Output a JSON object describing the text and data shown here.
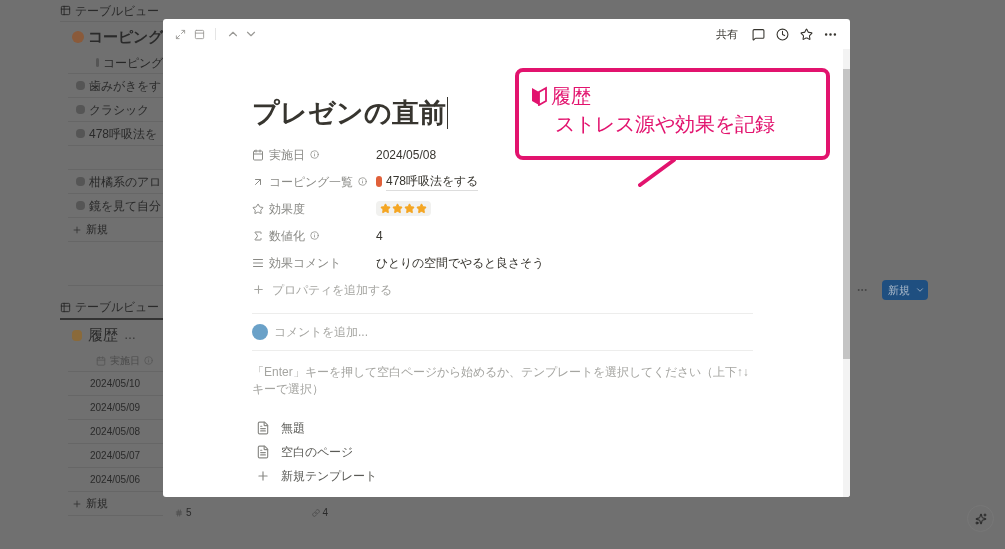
{
  "background": {
    "top_view": "テーブルビュー",
    "coping": {
      "title": "コーピング",
      "column": "コーピング",
      "rows": [
        "歯みがきをす",
        "クラシック",
        "478呼吸法を",
        "",
        "柑橘系のアロ",
        "鏡を見て自分"
      ],
      "new": "新規"
    },
    "history_view": "テーブルビュー",
    "history": {
      "title": "履歴",
      "more": "…",
      "column": "実施日",
      "rows": [
        "2024/05/10",
        "2024/05/09",
        "2024/05/08",
        "2024/05/07",
        "2024/05/06"
      ],
      "new": "新規"
    },
    "new_button": "新規",
    "footer": [
      "5",
      "4"
    ]
  },
  "modal": {
    "share": "共有",
    "title": "プレゼンの直前",
    "properties": [
      {
        "kind": "date",
        "label": "実施日",
        "info": true,
        "value": "2024/05/08"
      },
      {
        "kind": "relation",
        "label": "コーピング一覧",
        "info": true,
        "value": "478呼吸法をする"
      },
      {
        "kind": "stars",
        "label": "効果度",
        "info": false,
        "stars": 4
      },
      {
        "kind": "formula",
        "label": "数値化",
        "info": true,
        "value": "4"
      },
      {
        "kind": "text",
        "label": "効果コメント",
        "info": false,
        "value": "ひとりの空間でやると良さそう"
      }
    ],
    "add_property": "プロパティを追加する",
    "comment_placeholder": "コメントを追加...",
    "hint": "「Enter」キーを押して空白ページから始めるか、テンプレートを選択してください（上下↑↓キーで選択）",
    "templates": [
      {
        "kind": "page",
        "label": "無題"
      },
      {
        "kind": "page",
        "label": "空白のページ"
      },
      {
        "kind": "add",
        "label": "新規テンプレート"
      }
    ]
  },
  "callout": {
    "title": "履歴",
    "text": "ストレス源や効果を記録"
  }
}
